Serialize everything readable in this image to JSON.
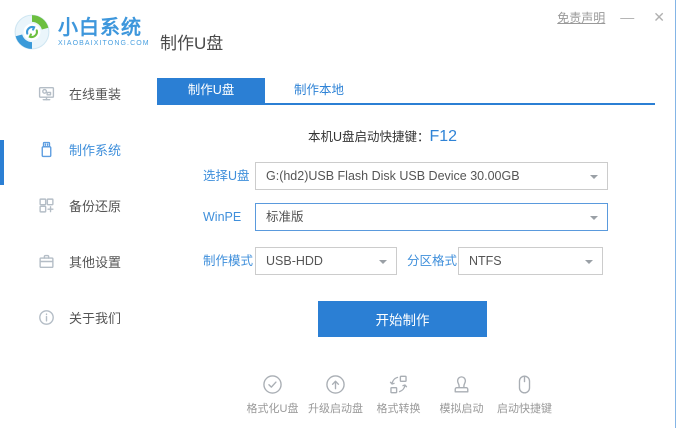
{
  "window": {
    "disclaimer": "免责声明",
    "minimize_glyph": "—",
    "close_glyph": "✕"
  },
  "brand": {
    "name": "小白系统",
    "domain": "XIAOBAIXITONG.COM"
  },
  "page_title": "制作U盘",
  "sidebar": {
    "items": [
      {
        "label": "在线重装",
        "icon": "monitor-reinstall-icon",
        "active": false
      },
      {
        "label": "制作系统",
        "icon": "usb-drive-icon",
        "active": true
      },
      {
        "label": "备份还原",
        "icon": "backup-grid-icon",
        "active": false
      },
      {
        "label": "其他设置",
        "icon": "toolbox-icon",
        "active": false
      },
      {
        "label": "关于我们",
        "icon": "info-icon",
        "active": false
      }
    ]
  },
  "tabs": [
    {
      "label": "制作U盘",
      "active": true
    },
    {
      "label": "制作本地",
      "active": false
    }
  ],
  "hotkey": {
    "prefix": "本机U盘启动快捷键：",
    "key": "F12"
  },
  "form": {
    "usb_label": "选择U盘",
    "usb_value": "G:(hd2)USB Flash Disk USB Device 30.00GB",
    "winpe_label": "WinPE",
    "winpe_value": "标准版",
    "mode_label": "制作模式",
    "mode_value": "USB-HDD",
    "partition_label": "分区格式",
    "partition_value": "NTFS"
  },
  "start_button_label": "开始制作",
  "footer_tools": [
    {
      "label": "格式化U盘",
      "icon": "format-check-icon"
    },
    {
      "label": "升级启动盘",
      "icon": "upgrade-arrow-icon"
    },
    {
      "label": "格式转换",
      "icon": "convert-icon"
    },
    {
      "label": "模拟启动",
      "icon": "stamp-icon"
    },
    {
      "label": "启动快捷键",
      "icon": "mouse-icon"
    }
  ],
  "colors": {
    "primary": "#2b7fd4",
    "link_blue": "#3f8fdb",
    "logo_blue": "#3e97dc",
    "logo_green": "#6cbf3f"
  }
}
